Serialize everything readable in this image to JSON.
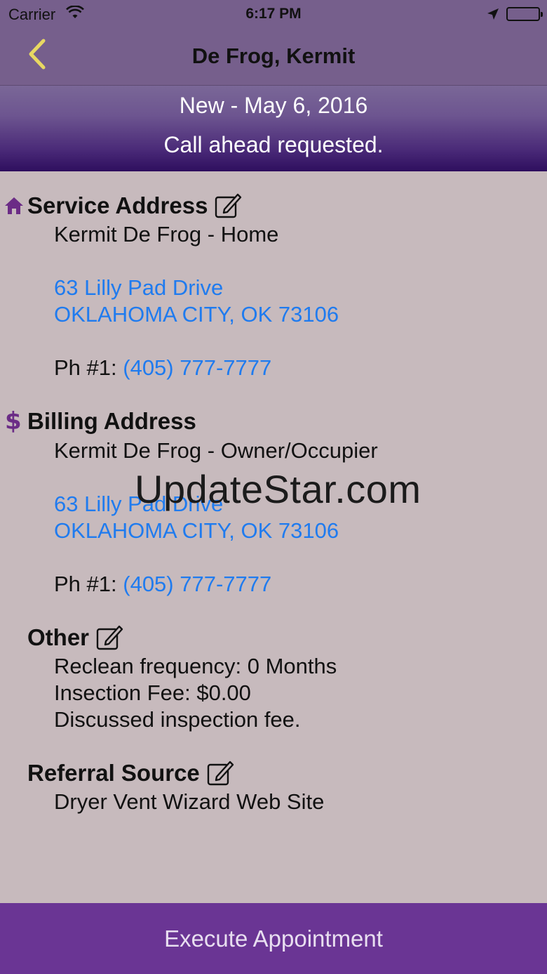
{
  "status_bar": {
    "carrier": "Carrier",
    "time": "6:17 PM"
  },
  "nav": {
    "title": "De Frog, Kermit",
    "back_icon": "chevron-left-icon",
    "back_color": "#e8d862"
  },
  "banner": {
    "status_line": "New - May 6, 2016",
    "note_line": "Call ahead requested."
  },
  "service_address": {
    "title": "Service Address",
    "icon": "home-icon",
    "name_line": "Kermit De Frog - Home",
    "street": "63 Lilly Pad Drive",
    "city_state_zip": "OKLAHOMA CITY, OK 73106",
    "phone_label": "Ph #1: ",
    "phone": "(405) 777-7777"
  },
  "billing_address": {
    "title": "Billing Address",
    "icon": "dollar-icon",
    "name_line": "Kermit De Frog - Owner/Occupier",
    "street": "63 Lilly Pad Drive",
    "city_state_zip": "OKLAHOMA CITY, OK 73106",
    "phone_label": "Ph #1: ",
    "phone": "(405) 777-7777"
  },
  "other": {
    "title": "Other",
    "reclean": "Reclean frequency: 0 Months",
    "fee": "Insection Fee: $0.00",
    "note": "Discussed inspection fee."
  },
  "referral": {
    "title": "Referral Source",
    "value": "Dryer Vent Wizard Web Site"
  },
  "watermark": "UpdateStar.com",
  "footer": {
    "execute_label": "Execute Appointment"
  },
  "colors": {
    "nav_bg": "#765f8c",
    "link": "#1f7bef",
    "accent_purple": "#6a3594",
    "icon_purple": "#6b2c86",
    "content_bg": "#c7babd"
  }
}
